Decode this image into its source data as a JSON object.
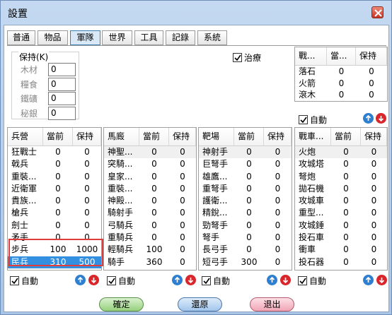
{
  "window": {
    "title": "設置",
    "close_icon": "close-icon"
  },
  "tabs": [
    {
      "label": "普通",
      "active": false
    },
    {
      "label": "物品",
      "active": false
    },
    {
      "label": "軍隊",
      "active": true
    },
    {
      "label": "世界",
      "active": false
    },
    {
      "label": "工具",
      "active": false
    },
    {
      "label": "記錄",
      "active": false
    },
    {
      "label": "系統",
      "active": false
    }
  ],
  "resources": {
    "legend": "保持(K)",
    "items": [
      {
        "label": "木材",
        "value": "0"
      },
      {
        "label": "糧食",
        "value": "0"
      },
      {
        "label": "鐵礦",
        "value": "0"
      },
      {
        "label": "秘銀",
        "value": "0"
      }
    ]
  },
  "heal_checkbox": {
    "label": "治療",
    "checked": true
  },
  "tower_panel": {
    "columns": [
      "戰...",
      "當...",
      "保持"
    ],
    "rows": [
      [
        "落石",
        "0",
        "0"
      ],
      [
        "火箭",
        "0",
        "0"
      ],
      [
        "滾木",
        "0",
        "0"
      ]
    ],
    "auto_label": "自動"
  },
  "barracks_panel": {
    "columns": [
      "兵營",
      "當前",
      "保持"
    ],
    "rows": [
      [
        "狂戰士",
        "0",
        "0"
      ],
      [
        "戟兵",
        "0",
        "0"
      ],
      [
        "重裝...",
        "0",
        "0"
      ],
      [
        "近衛軍",
        "0",
        "0"
      ],
      [
        "貴族...",
        "0",
        "0"
      ],
      [
        "槍兵",
        "0",
        "0"
      ],
      [
        "劍士",
        "0",
        "0"
      ],
      [
        "矛手",
        "0",
        "0"
      ],
      [
        "步兵",
        "100",
        "1000"
      ],
      [
        "民兵",
        "310",
        "500"
      ]
    ],
    "auto_label": "自動"
  },
  "stable_panel": {
    "columns": [
      "馬廄",
      "當前",
      "保持"
    ],
    "rows": [
      [
        "神聖...",
        "0",
        "0"
      ],
      [
        "突騎...",
        "0",
        "0"
      ],
      [
        "皇家...",
        "0",
        "0"
      ],
      [
        "重裝...",
        "0",
        "0"
      ],
      [
        "神殿...",
        "0",
        "0"
      ],
      [
        "騎射手",
        "0",
        "0"
      ],
      [
        "弓騎兵",
        "0",
        "0"
      ],
      [
        "重騎兵",
        "0",
        "0"
      ],
      [
        "輕騎兵",
        "100",
        "0"
      ],
      [
        "騎手",
        "360",
        "0"
      ]
    ],
    "auto_label": "自動"
  },
  "range_panel": {
    "columns": [
      "靶場",
      "當前",
      "保持"
    ],
    "rows": [
      [
        "神射手",
        "0",
        "0"
      ],
      [
        "巨弩手",
        "0",
        "0"
      ],
      [
        "雄鷹...",
        "0",
        "0"
      ],
      [
        "重弩手",
        "0",
        "0"
      ],
      [
        "護衛...",
        "0",
        "0"
      ],
      [
        "精銳...",
        "0",
        "0"
      ],
      [
        "勁弩手",
        "0",
        "0"
      ],
      [
        "弩手",
        "0",
        "0"
      ],
      [
        "長弓手",
        "0",
        "0"
      ],
      [
        "短弓手",
        "300",
        "0"
      ]
    ],
    "auto_label": "自動"
  },
  "siege_panel": {
    "columns": [
      "戰車...",
      "當前",
      "保持"
    ],
    "rows": [
      [
        "火炮",
        "0",
        "0"
      ],
      [
        "攻城塔",
        "0",
        "0"
      ],
      [
        "弩炮",
        "0",
        "0"
      ],
      [
        "拋石機",
        "0",
        "0"
      ],
      [
        "攻城車",
        "0",
        "0"
      ],
      [
        "重型...",
        "0",
        "0"
      ],
      [
        "攻城錘",
        "0",
        "0"
      ],
      [
        "投石車",
        "0",
        "0"
      ],
      [
        "衝車",
        "0",
        "0"
      ],
      [
        "投石器",
        "0",
        "0"
      ]
    ],
    "auto_label": "自動"
  },
  "buttons": {
    "ok": "確定",
    "reset": "還原",
    "exit": "退出"
  },
  "colors": {
    "selected_row": "#3390e0",
    "highlight_border": "#e03c3c",
    "up_arrow": "#2f7fd0",
    "down_arrow": "#d8262b"
  }
}
